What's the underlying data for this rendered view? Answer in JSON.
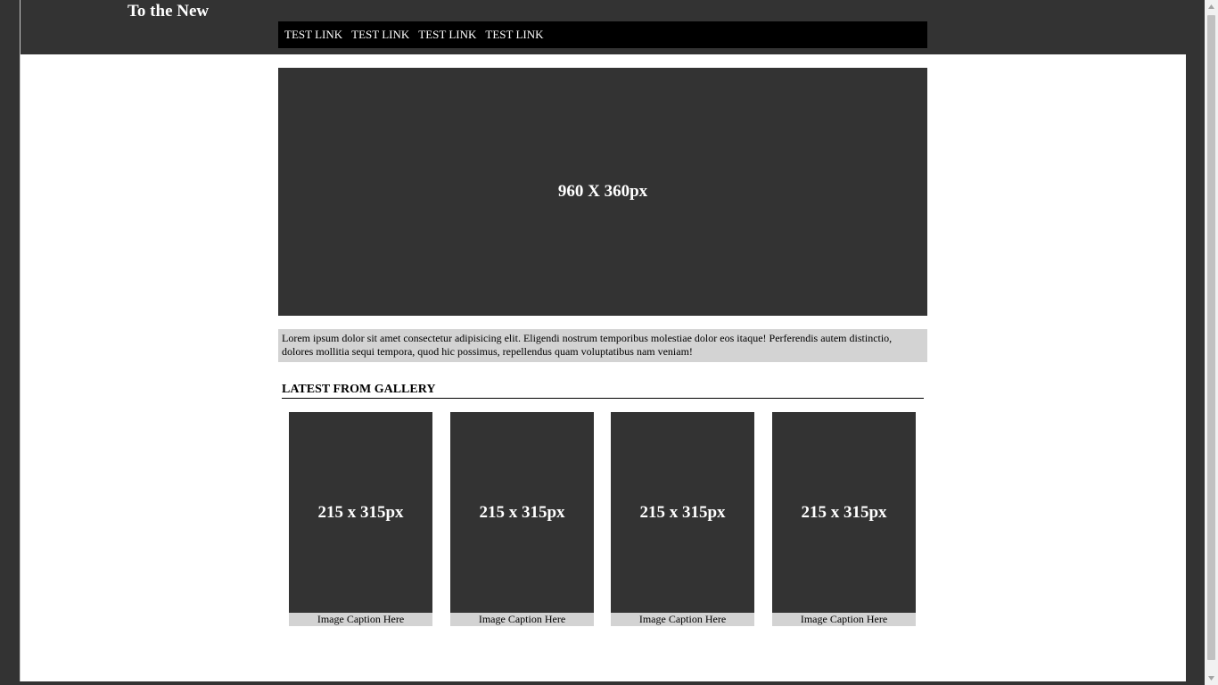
{
  "header": {
    "title": "To the New",
    "nav_links": [
      "TEST LINK",
      "TEST LINK",
      "TEST LINK",
      "TEST LINK"
    ]
  },
  "hero": {
    "label": "960 X 360px"
  },
  "intro": {
    "text": "Lorem ipsum dolor sit amet consectetur adipisicing elit. Eligendi nostrum temporibus molestiae dolor eos itaque! Perferendis autem distinctio, dolores mollitia sequi tempora, quod hic possimus, repellendus quam voluptatibus nam veniam!"
  },
  "gallery": {
    "heading": "LATEST FROM GALLERY",
    "items": [
      {
        "label": "215 x 315px",
        "caption": "Image Caption Here"
      },
      {
        "label": "215 x 315px",
        "caption": "Image Caption Here"
      },
      {
        "label": "215 x 315px",
        "caption": "Image Caption Here"
      },
      {
        "label": "215 x 315px",
        "caption": "Image Caption Here"
      }
    ]
  },
  "colors": {
    "dark": "#333333",
    "nav_bg": "#000000",
    "caption_bg": "#d3d3d3",
    "page_bg": "#ffffff"
  },
  "icons": {
    "scroll_up": "triangle-up-icon",
    "scroll_down": "triangle-down-icon"
  }
}
